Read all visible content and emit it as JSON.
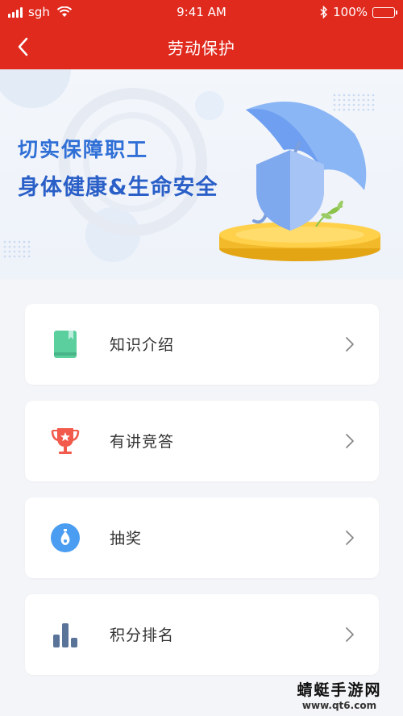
{
  "status_bar": {
    "carrier": "sgh",
    "time": "9:41 AM",
    "battery": "100%",
    "battery_level": 1.0,
    "icons": [
      "signal-icon",
      "wifi-icon",
      "bluetooth-icon",
      "battery-icon"
    ]
  },
  "nav": {
    "title": "劳动保护",
    "back_icon": "chevron-left-icon"
  },
  "banner": {
    "line1": "切实保障职工",
    "line2": "身体健康&生命安全"
  },
  "menu": [
    {
      "label": "知识介绍",
      "icon": "book-icon",
      "color": "#5ccf9f"
    },
    {
      "label": "有讲竞答",
      "icon": "trophy-icon",
      "color": "#f25a4b"
    },
    {
      "label": "抽奖",
      "icon": "lottery-icon",
      "color": "#4a9df0"
    },
    {
      "label": "积分排名",
      "icon": "bar-chart-icon",
      "color": "#5a7398"
    }
  ],
  "watermark": {
    "line1": "蜻蜓手游网",
    "line2": "www.qt6.com"
  },
  "colors": {
    "brand_red": "#e02a1e",
    "banner_blue": "#2f6fd6"
  }
}
